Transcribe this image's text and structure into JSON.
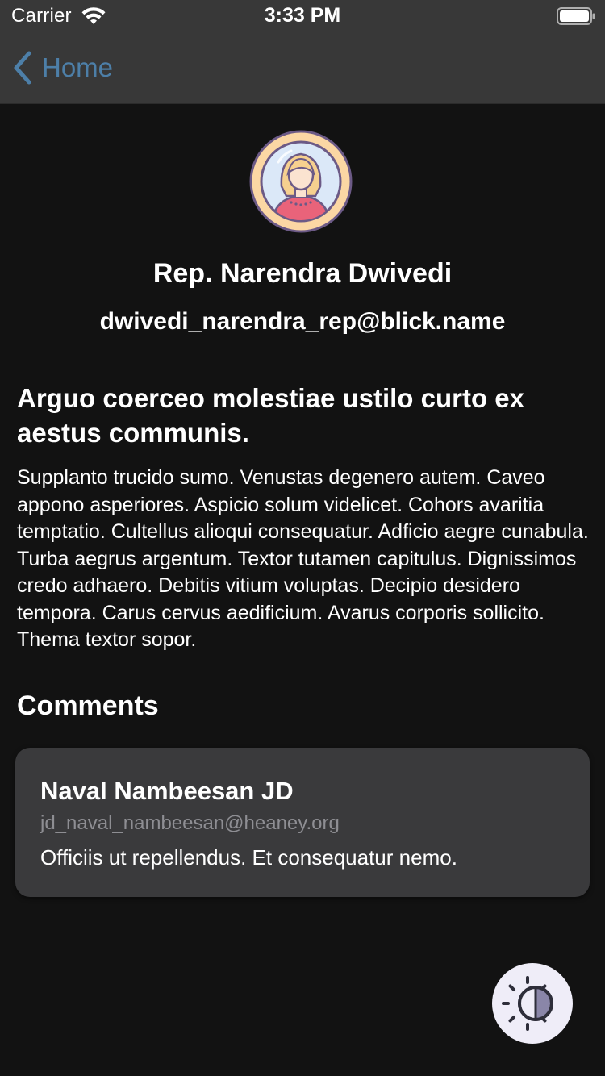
{
  "status_bar": {
    "carrier": "Carrier",
    "time": "3:33 PM",
    "wifi_icon": "wifi-icon",
    "battery_icon": "battery-full-icon"
  },
  "nav": {
    "back_label": "Home",
    "back_icon": "chevron-left-icon",
    "accent_color": "#4d7fa8"
  },
  "profile": {
    "avatar_icon": "female-user-avatar-icon",
    "name": "Rep. Narendra Dwivedi",
    "email": "dwivedi_narendra_rep@blick.name"
  },
  "post": {
    "title": "Arguo coerceo molestiae ustilo curto ex aestus communis.",
    "body": "Supplanto trucido sumo. Venustas degenero autem. Caveo appono asperiores. Aspicio solum videlicet. Cohors avaritia temptatio. Cultellus alioqui consequatur. Adficio aegre cunabula. Turba aegrus argentum. Textor tutamen capitulus. Dignissimos credo adhaero. Debitis vitium voluptas. Decipio desidero tempora. Carus cervus aedificium. Avarus corporis sollicito. Thema textor sopor."
  },
  "comments": {
    "heading": "Comments",
    "items": [
      {
        "author": "Naval Nambeesan JD",
        "email": "jd_naval_nambeesan@heaney.org",
        "text": "Officiis ut repellendus. Et consequatur nemo."
      }
    ]
  },
  "theme_toggle": {
    "icon": "brightness-contrast-icon"
  },
  "colors": {
    "background": "#121212",
    "bar": "#383838",
    "card": "#3a3a3c",
    "muted_text": "#8e8e93"
  }
}
